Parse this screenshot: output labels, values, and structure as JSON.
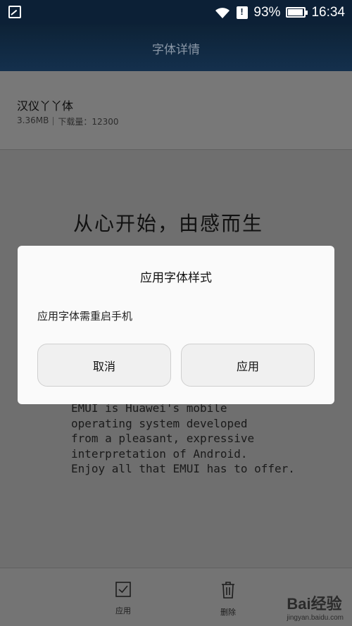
{
  "status_bar": {
    "battery_percent": "93%",
    "battery_level": 0.93,
    "time": "16:34",
    "icons": [
      "gallery-icon",
      "wifi-icon",
      "sim-alert-icon",
      "battery-icon"
    ]
  },
  "header": {
    "title": "字体详情"
  },
  "font": {
    "name": "汉仪丫丫体",
    "size": "3.36MB",
    "downloads": "下载量：12300"
  },
  "preview": {
    "title": "从心开始，由感而生",
    "lines": [
      "EMUI is Huawei's mobile",
      "operating system developed",
      "from a pleasant, expressive",
      "interpretation of Android.",
      "Enjoy all that EMUI has to offer."
    ]
  },
  "dialog": {
    "title": "应用字体样式",
    "message": "应用字体需重启手机",
    "cancel_label": "取消",
    "apply_label": "应用"
  },
  "bottom_bar": {
    "apply_label": "应用",
    "delete_label": "删除"
  },
  "watermark": {
    "brand": "Bai经验",
    "url": "jingyan.baidu.com"
  }
}
